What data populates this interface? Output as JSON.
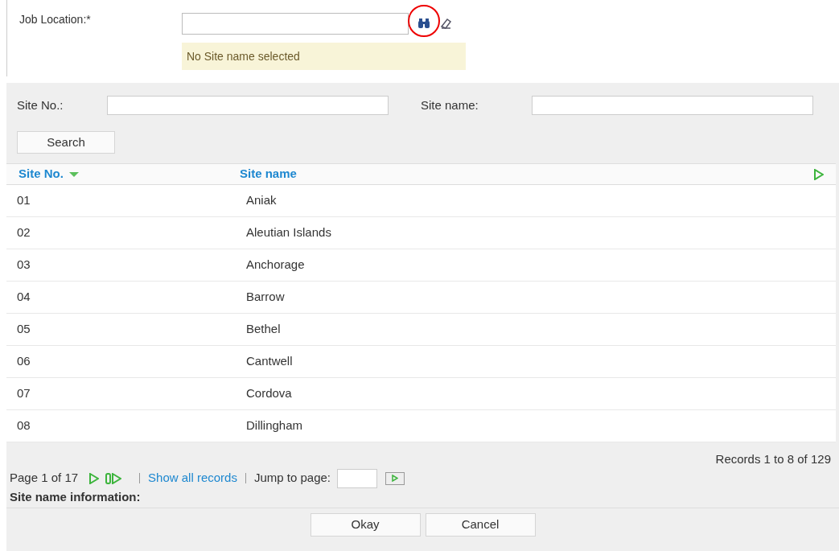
{
  "job_location": {
    "label": "Job Location:*",
    "message": "No Site name selected"
  },
  "search_form": {
    "fields": [
      {
        "label": "Site No.:"
      },
      {
        "label": "Site name:"
      }
    ],
    "button": "Search"
  },
  "table": {
    "columns": [
      "Site No.",
      "Site name"
    ],
    "rows": [
      [
        "01",
        "Aniak"
      ],
      [
        "02",
        "Aleutian Islands"
      ],
      [
        "03",
        "Anchorage"
      ],
      [
        "04",
        "Barrow"
      ],
      [
        "05",
        "Bethel"
      ],
      [
        "06",
        "Cantwell"
      ],
      [
        "07",
        "Cordova"
      ],
      [
        "08",
        "Dillingham"
      ]
    ]
  },
  "pager": {
    "records": "Records 1 to 8 of 129",
    "page": "Page 1 of 17",
    "show_all": "Show all records",
    "jump_label": "Jump to page:"
  },
  "info_label": "Site name information:",
  "buttons": [
    "Okay",
    "Cancel"
  ]
}
